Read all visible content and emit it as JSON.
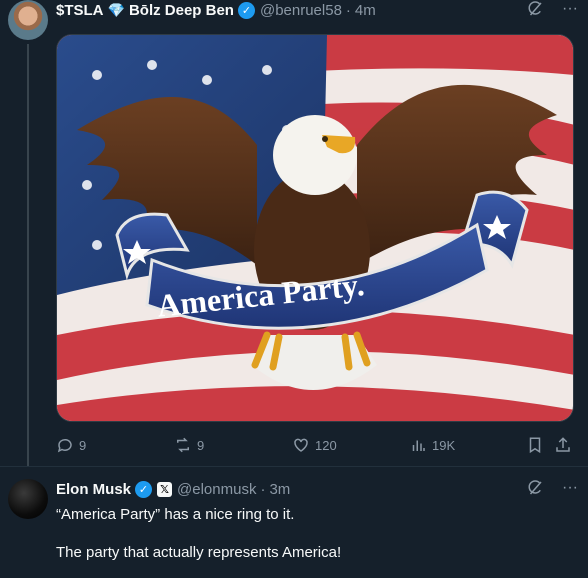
{
  "tweet1": {
    "author_name": "$TSLA",
    "author_name2": "Bōlz Deep Ben",
    "handle": "@benruel58",
    "time": "4m",
    "image_banner_text": "America Party.",
    "actions": {
      "replies": "9",
      "retweets": "9",
      "likes": "120",
      "views": "19K"
    }
  },
  "tweet2": {
    "author_name": "Elon Musk",
    "handle": "@elonmusk",
    "time": "3m",
    "text_line1": "“America Party” has a nice ring to it.",
    "text_line2": "The party that actually represents America!"
  },
  "icons": {
    "gem": "💎",
    "more": "···",
    "check": "✓",
    "x_badge": "𝕏"
  },
  "colors": {
    "background": "#15202b",
    "accent": "#1d9bf0",
    "muted": "#8b98a5"
  }
}
